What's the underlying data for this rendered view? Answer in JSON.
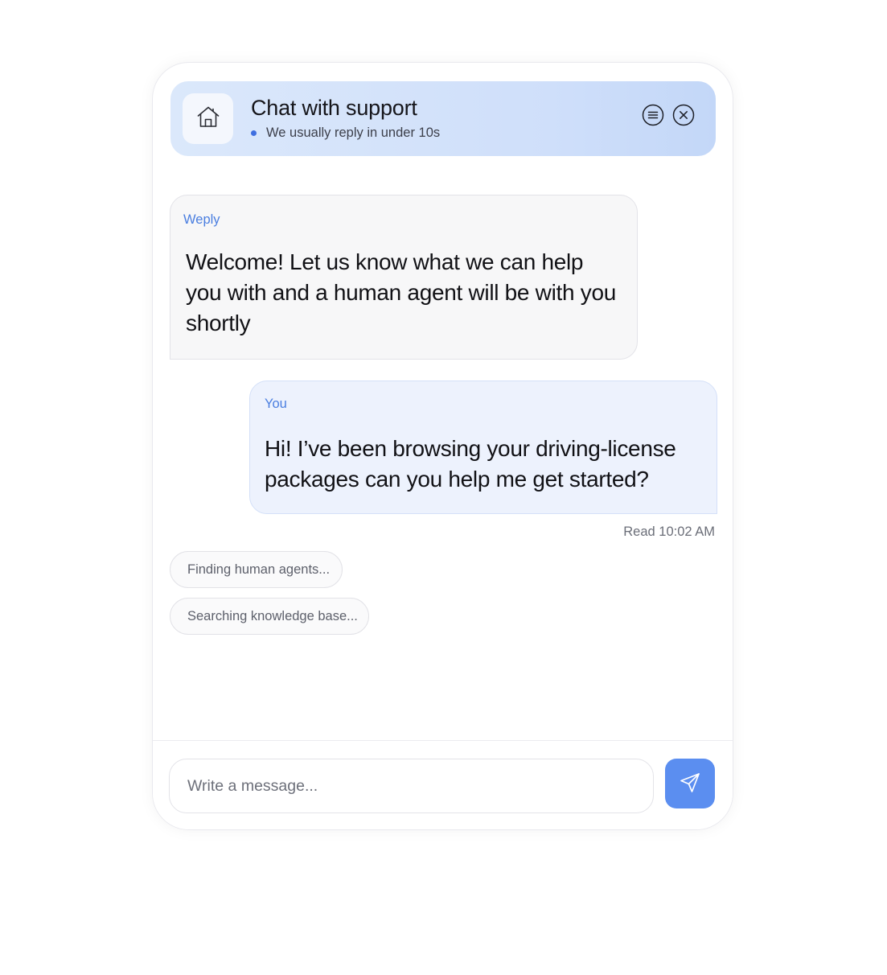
{
  "header": {
    "title": "Chat with support",
    "status": "We usually reply in under 10s",
    "home_icon": "home-icon",
    "menu_icon": "menu-icon",
    "close_icon": "close-icon"
  },
  "messages": [
    {
      "sender": "Weply",
      "text": "Welcome! Let us know what we can help you with and a human agent will be with you shortly"
    },
    {
      "sender": "You",
      "text": "Hi! I’ve been browsing your driving-license packages can you help me get started?"
    }
  ],
  "read_receipt": "Read 10:02 AM",
  "status_chips": [
    "Finding human agents...",
    "Searching knowledge base..."
  ],
  "composer": {
    "placeholder": "Write a message...",
    "send_icon": "send-icon"
  },
  "colors": {
    "accent": "#5b8ef0",
    "sender_label": "#4a7ee0",
    "status_dot": "#3f6fe0",
    "header_bg": "#d6e4fa",
    "user_bubble": "#edf2fd",
    "agent_bubble": "#f7f7f8"
  }
}
